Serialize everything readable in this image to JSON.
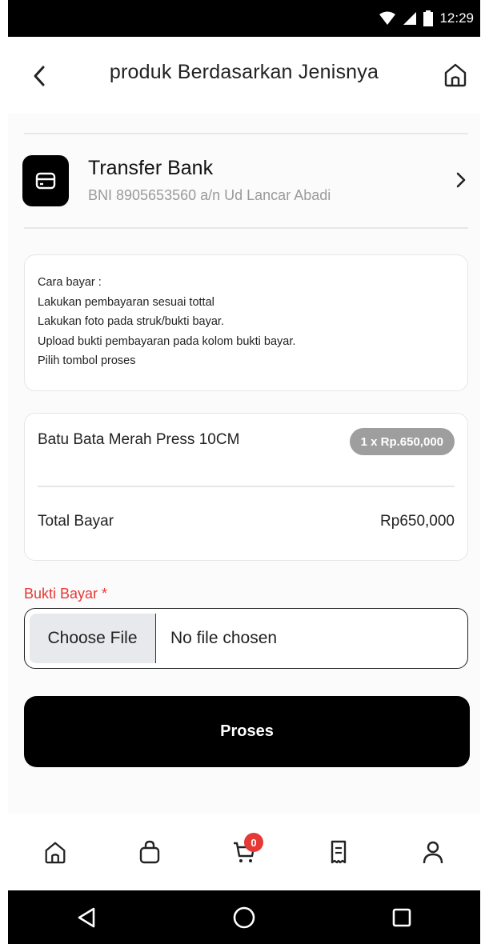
{
  "status_bar": {
    "time": "12:29"
  },
  "header": {
    "title": "produk Berdasarkan Jenisnya",
    "back_icon": "chevron-left-icon",
    "home_icon": "home-icon"
  },
  "payment_method": {
    "name": "Transfer Bank",
    "account": "BNI 8905653560 a/n Ud Lancar Abadi",
    "icon": "card-icon"
  },
  "instructions": [
    "Cara bayar :",
    "Lakukan pembayaran sesuai tottal",
    "Lakukan foto pada struk/bukti bayar.",
    "Upload bukti pembayaran pada kolom bukti bayar.",
    "Pilih tombol proses"
  ],
  "order": {
    "product_name": "Batu Bata Merah Press 10CM",
    "quantity_badge": "1 x Rp.650,000",
    "total_label": "Total Bayar",
    "total_value": "Rp650,000"
  },
  "proof": {
    "label": "Bukti Bayar *",
    "choose_button": "Choose File",
    "file_status": "No file chosen"
  },
  "submit_label": "Proses",
  "bottom_nav": {
    "items": [
      "home-icon",
      "shopping-bag-icon",
      "cart-icon",
      "receipt-icon",
      "user-icon"
    ],
    "cart_count": "0"
  },
  "colors": {
    "accent_red": "#e53935",
    "primary": "#000000",
    "badge_gray": "#9e9e9e"
  }
}
